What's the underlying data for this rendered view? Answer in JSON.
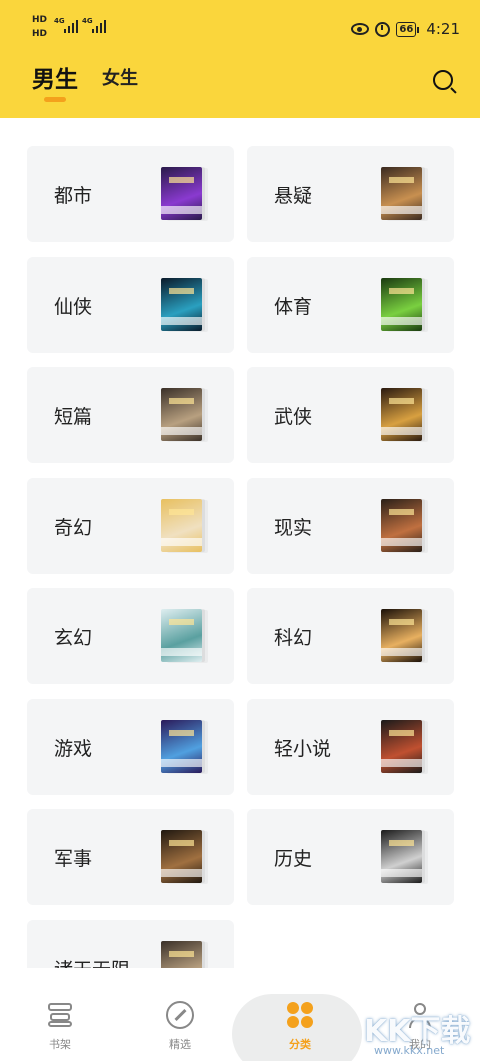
{
  "status_bar": {
    "network_hd_top": "HD",
    "network_hd_bottom": "HD",
    "signal_1": "4G",
    "signal_2": "4G",
    "battery": "66",
    "time": "4:21"
  },
  "header": {
    "tabs": [
      {
        "label": "男生",
        "active": true
      },
      {
        "label": "女生",
        "active": false
      }
    ],
    "search_icon": "search-icon",
    "accent_color": "#fad63c",
    "indicator_color": "#f4a11c"
  },
  "categories": [
    {
      "label": "都市",
      "cover_colors": [
        "#2a1a4a",
        "#8a3ad0"
      ]
    },
    {
      "label": "悬疑",
      "cover_colors": [
        "#3a2a20",
        "#c89050"
      ]
    },
    {
      "label": "仙侠",
      "cover_colors": [
        "#0a1a2a",
        "#2aa0c0"
      ]
    },
    {
      "label": "体育",
      "cover_colors": [
        "#1a3a10",
        "#7ad040"
      ]
    },
    {
      "label": "短篇",
      "cover_colors": [
        "#3a3028",
        "#b8a080"
      ]
    },
    {
      "label": "武侠",
      "cover_colors": [
        "#2a1a10",
        "#d8a040"
      ]
    },
    {
      "label": "奇幻",
      "cover_colors": [
        "#e8c060",
        "#f0e0c0"
      ]
    },
    {
      "label": "现实",
      "cover_colors": [
        "#2a2018",
        "#c07040"
      ]
    },
    {
      "label": "玄幻",
      "cover_colors": [
        "#dfeef0",
        "#5aa0a0"
      ]
    },
    {
      "label": "科幻",
      "cover_colors": [
        "#1a1008",
        "#e8b060"
      ]
    },
    {
      "label": "游戏",
      "cover_colors": [
        "#2a1a5a",
        "#50a0e0"
      ]
    },
    {
      "label": "轻小说",
      "cover_colors": [
        "#1a1a1a",
        "#c05030"
      ]
    },
    {
      "label": "军事",
      "cover_colors": [
        "#201810",
        "#a07040"
      ]
    },
    {
      "label": "历史",
      "cover_colors": [
        "#1a1a1a",
        "#d0d0d0"
      ]
    },
    {
      "label": "诸天无限",
      "cover_colors": [
        "#3a3028",
        "#b8a080"
      ]
    }
  ],
  "bottom_nav": [
    {
      "label": "书架",
      "icon": "bookshelf-icon",
      "active": false
    },
    {
      "label": "精选",
      "icon": "compass-icon",
      "active": false
    },
    {
      "label": "分类",
      "icon": "category-icon",
      "active": true
    },
    {
      "label": "我的",
      "icon": "profile-icon",
      "active": false
    }
  ],
  "watermark": {
    "text": "KK下载",
    "url": "www.kkx.net"
  }
}
